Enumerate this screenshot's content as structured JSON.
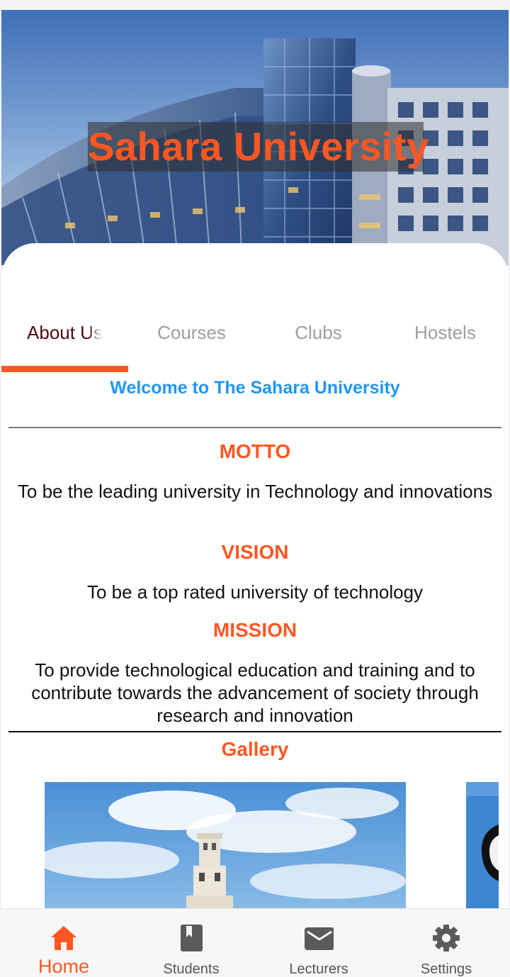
{
  "header": {
    "title": "Sahara University"
  },
  "tabs": [
    {
      "label": "About Us",
      "active": true
    },
    {
      "label": "Courses",
      "active": false
    },
    {
      "label": "Clubs",
      "active": false
    },
    {
      "label": "Hostels",
      "active": false
    }
  ],
  "about": {
    "welcome": "Welcome to The Sahara University",
    "motto_heading": "MOTTO",
    "motto_text": "To be the leading university in Technology and innovations",
    "vision_heading": "VISION",
    "vision_text": "To be a top rated university of technology",
    "mission_heading": "MISSION",
    "mission_text": "To provide technological education and training and to contribute towards the advancement of society through research and innovation",
    "gallery_heading": "Gallery"
  },
  "bottom_nav": [
    {
      "label": "Home",
      "icon": "home-icon",
      "active": true
    },
    {
      "label": "Students",
      "icon": "book-icon",
      "active": false
    },
    {
      "label": "Lecturers",
      "icon": "mail-icon",
      "active": false
    },
    {
      "label": "Settings",
      "icon": "gear-icon",
      "active": false
    }
  ],
  "colors": {
    "accent": "#ff5722",
    "link_blue": "#2196f3",
    "active_tab_text": "#4a0a14",
    "inactive_text": "#9e9e9e"
  }
}
